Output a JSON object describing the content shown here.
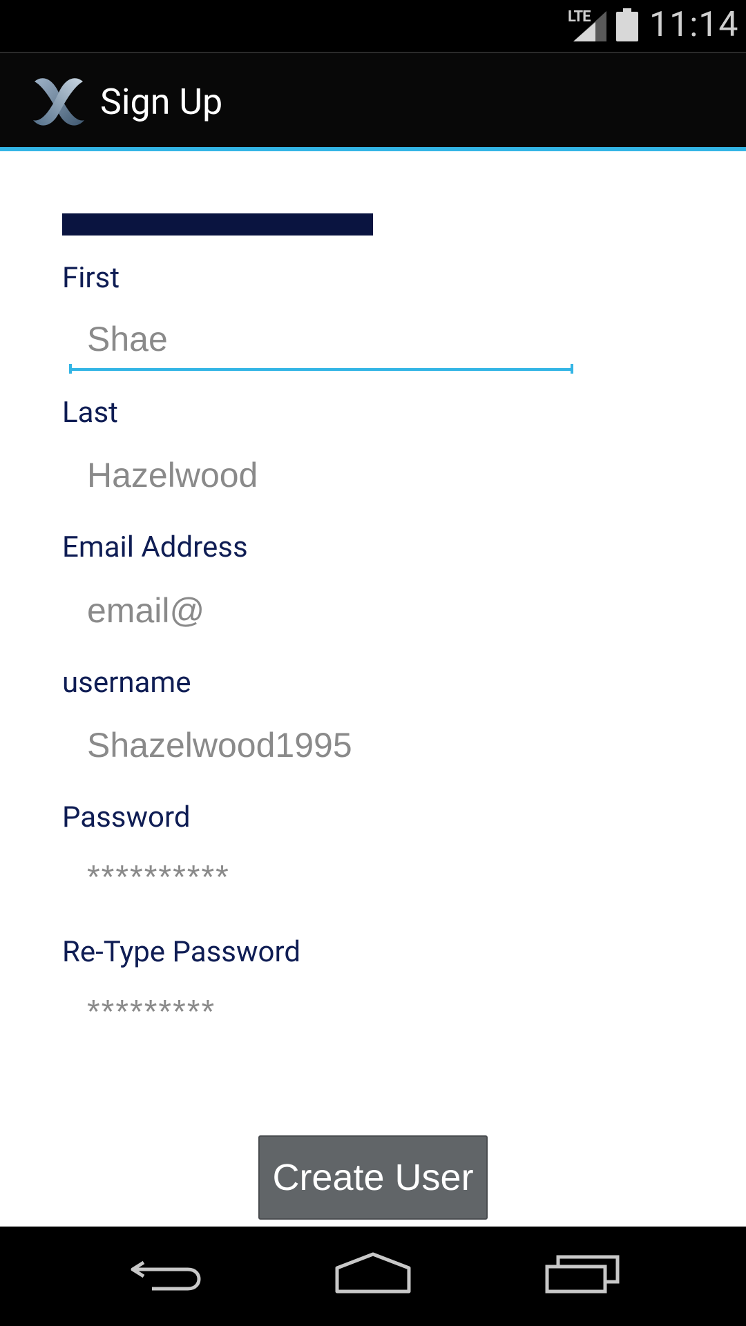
{
  "status_bar": {
    "network_label": "LTE",
    "time": "11:14",
    "icons": [
      "signal-icon",
      "battery-icon"
    ]
  },
  "action_bar": {
    "title": "Sign Up",
    "icon": "app-logo-icon",
    "accent_color": "#33b5e5"
  },
  "form": {
    "fields": [
      {
        "label": "First",
        "value": "Shae"
      },
      {
        "label": "Last",
        "value": "Hazelwood"
      },
      {
        "label": "Email Address",
        "value": "email@"
      },
      {
        "label": "username",
        "value": "Shazelwood1995"
      },
      {
        "label": "Password",
        "value": "**********"
      },
      {
        "label": "Re-Type Password",
        "value": "*********"
      }
    ],
    "submit_label": "Create User"
  },
  "nav_bar": {
    "icons": [
      "back-icon",
      "home-icon",
      "recents-icon"
    ]
  },
  "colors": {
    "label": "#0f1d54",
    "input_text": "#8a8a8a",
    "button": "#616568"
  }
}
